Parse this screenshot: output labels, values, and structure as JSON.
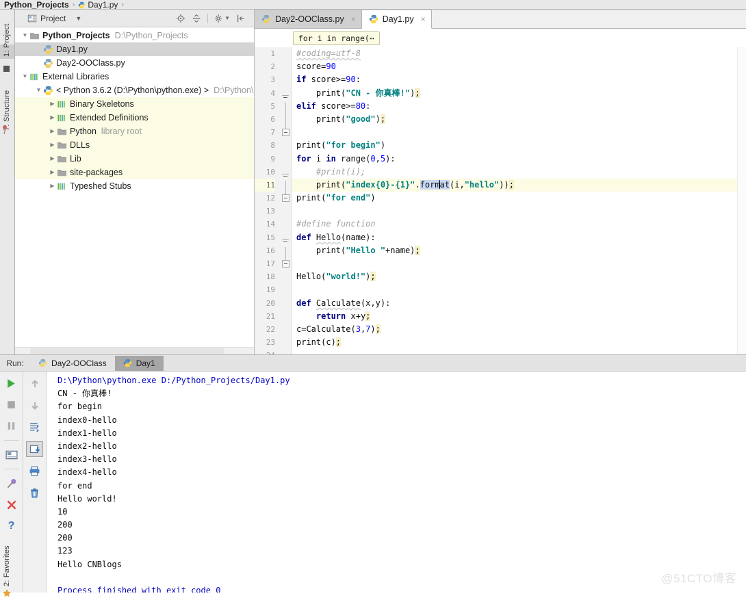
{
  "window": {
    "breadcrumb": {
      "project": "Python_Projects",
      "separator": "›",
      "file": "Day1.py",
      "separator2": "›"
    },
    "watermark": "@51CTO博客"
  },
  "left_strip": {
    "tabs": [
      {
        "label": "1: Project",
        "active": true
      },
      {
        "label": "7: Structure",
        "active": false
      },
      {
        "label": "2: Favorites",
        "active": false
      }
    ]
  },
  "project_panel": {
    "title": "Project",
    "caret": "▼",
    "tools": [
      {
        "name": "locate-icon",
        "title": "Scroll from Source"
      },
      {
        "name": "collapse-all-icon",
        "title": "Collapse All"
      },
      {
        "name": "gear-icon",
        "title": "Settings"
      },
      {
        "name": "hide-icon",
        "title": "Hide"
      }
    ],
    "tree": [
      {
        "indent": 0,
        "arrow": "down",
        "icon": "folder-icon",
        "label": "Python_Projects",
        "bold": true,
        "dim": "D:\\Python_Projects",
        "selected": false,
        "libhl": false
      },
      {
        "indent": 1,
        "arrow": "none",
        "icon": "python-file-icon",
        "label": "Day1.py",
        "bold": false,
        "dim": "",
        "selected": true,
        "libhl": false
      },
      {
        "indent": 1,
        "arrow": "none",
        "icon": "python-file-icon",
        "label": "Day2-OOClass.py",
        "bold": false,
        "dim": "",
        "selected": false,
        "libhl": false
      },
      {
        "indent": 0,
        "arrow": "down",
        "icon": "library-icon",
        "label": "External Libraries",
        "bold": false,
        "dim": "",
        "selected": false,
        "libhl": false
      },
      {
        "indent": 1,
        "arrow": "down",
        "icon": "python-sdk-icon",
        "label": "< Python 3.6.2 (D:\\Python\\python.exe) >",
        "bold": false,
        "dim": "D:\\Python\\p",
        "selected": false,
        "libhl": false
      },
      {
        "indent": 2,
        "arrow": "right",
        "icon": "library-icon",
        "label": "Binary Skeletons",
        "bold": false,
        "dim": "",
        "selected": false,
        "libhl": true
      },
      {
        "indent": 2,
        "arrow": "right",
        "icon": "library-icon",
        "label": "Extended Definitions",
        "bold": false,
        "dim": "",
        "selected": false,
        "libhl": true
      },
      {
        "indent": 2,
        "arrow": "right",
        "icon": "folder-icon",
        "label": "Python",
        "bold": false,
        "dim": "library root",
        "selected": false,
        "libhl": true
      },
      {
        "indent": 2,
        "arrow": "right",
        "icon": "folder-icon",
        "label": "DLLs",
        "bold": false,
        "dim": "",
        "selected": false,
        "libhl": true
      },
      {
        "indent": 2,
        "arrow": "right",
        "icon": "folder-icon",
        "label": "Lib",
        "bold": false,
        "dim": "",
        "selected": false,
        "libhl": true
      },
      {
        "indent": 2,
        "arrow": "right",
        "icon": "folder-icon",
        "label": "site-packages",
        "bold": false,
        "dim": "",
        "selected": false,
        "libhl": true
      },
      {
        "indent": 2,
        "arrow": "right",
        "icon": "library-icon",
        "label": "Typeshed Stubs",
        "bold": false,
        "dim": "",
        "selected": false,
        "libhl": false
      }
    ]
  },
  "editor": {
    "tabs": [
      {
        "label": "Day2-OOClass.py",
        "active": false,
        "close": "×"
      },
      {
        "label": "Day1.py",
        "active": true,
        "close": "×"
      }
    ],
    "breadcrumb_chip": "for i in range(⋯",
    "line_numbers": [
      "1",
      "2",
      "3",
      "4",
      "5",
      "6",
      "7",
      "8",
      "9",
      "10",
      "11",
      "12",
      "13",
      "14",
      "15",
      "16",
      "17",
      "18",
      "19",
      "20",
      "21",
      "22",
      "23",
      "24"
    ],
    "highlighted_line": 11,
    "lines": [
      {
        "n": 1,
        "text": "#coding=utf-8"
      },
      {
        "n": 2,
        "text": "score=90"
      },
      {
        "n": 3,
        "text": "if score>=90:"
      },
      {
        "n": 4,
        "text": "    print(\"CN - 你真棒!\");"
      },
      {
        "n": 5,
        "text": "elif score>=80:"
      },
      {
        "n": 6,
        "text": "    print(\"good\");"
      },
      {
        "n": 7,
        "text": ""
      },
      {
        "n": 8,
        "text": "print(\"for begin\")"
      },
      {
        "n": 9,
        "text": "for i in range(0,5):"
      },
      {
        "n": 10,
        "text": "    #print(i);"
      },
      {
        "n": 11,
        "text": "    print(\"index{0}-{1}\".format(i,\"hello\"));"
      },
      {
        "n": 12,
        "text": "print(\"for end\")"
      },
      {
        "n": 13,
        "text": ""
      },
      {
        "n": 14,
        "text": "#define function"
      },
      {
        "n": 15,
        "text": "def Hello(name):"
      },
      {
        "n": 16,
        "text": "    print(\"Hello \"+name);"
      },
      {
        "n": 17,
        "text": ""
      },
      {
        "n": 18,
        "text": "Hello(\"world!\");"
      },
      {
        "n": 19,
        "text": ""
      },
      {
        "n": 20,
        "text": "def Calculate(x,y):"
      },
      {
        "n": 21,
        "text": "    return x+y;"
      },
      {
        "n": 22,
        "text": "c=Calculate(3,7);"
      },
      {
        "n": 23,
        "text": "print(c);"
      },
      {
        "n": 24,
        "text": ""
      }
    ]
  },
  "run_panel": {
    "label": "Run:",
    "tabs": [
      {
        "label": "Day2-OOClass",
        "active": false
      },
      {
        "label": "Day1",
        "active": true
      }
    ],
    "tools_left": [
      {
        "name": "run-icon",
        "title": "Rerun"
      },
      {
        "name": "stop-icon",
        "title": "Stop"
      },
      {
        "name": "pause-icon",
        "title": "Pause Output"
      },
      {
        "name": "console-icon",
        "title": "Console"
      },
      {
        "name": "pin-icon",
        "title": "Pin Tab"
      },
      {
        "name": "close-icon",
        "title": "Close"
      },
      {
        "name": "help-icon",
        "title": "Help"
      }
    ],
    "tools_right": [
      {
        "name": "arrow-up-icon",
        "title": "Up the Stack Trace"
      },
      {
        "name": "arrow-down-icon",
        "title": "Down the Stack Trace"
      },
      {
        "name": "soft-wrap-icon",
        "title": "Use Soft Wraps"
      },
      {
        "name": "scroll-to-end-icon",
        "title": "Scroll to End",
        "pressed": true
      },
      {
        "name": "print-icon",
        "title": "Print"
      },
      {
        "name": "trash-icon",
        "title": "Clear All"
      }
    ],
    "console_output": [
      {
        "text": "D:\\Python\\python.exe D:/Python_Projects/Day1.py",
        "link": true
      },
      {
        "text": "CN - 你真棒!",
        "link": false
      },
      {
        "text": "for begin",
        "link": false
      },
      {
        "text": "index0-hello",
        "link": false
      },
      {
        "text": "index1-hello",
        "link": false
      },
      {
        "text": "index2-hello",
        "link": false
      },
      {
        "text": "index3-hello",
        "link": false
      },
      {
        "text": "index4-hello",
        "link": false
      },
      {
        "text": "for end",
        "link": false
      },
      {
        "text": "Hello world!",
        "link": false
      },
      {
        "text": "10",
        "link": false
      },
      {
        "text": "200",
        "link": false
      },
      {
        "text": "200",
        "link": false
      },
      {
        "text": "123",
        "link": false
      },
      {
        "text": "Hello CNBlogs",
        "link": false
      },
      {
        "text": "",
        "link": false
      },
      {
        "text": "Process finished with exit code 0",
        "link": true
      }
    ]
  },
  "colors": {
    "keyword": "#000080",
    "number": "#0000ff",
    "string": "#008080",
    "comment": "#a0a0a0",
    "line_highlight": "#fcfbe3",
    "selection": "#c8d8f5",
    "console_link": "#0000c0",
    "panel_bg": "#e9e9e9"
  }
}
